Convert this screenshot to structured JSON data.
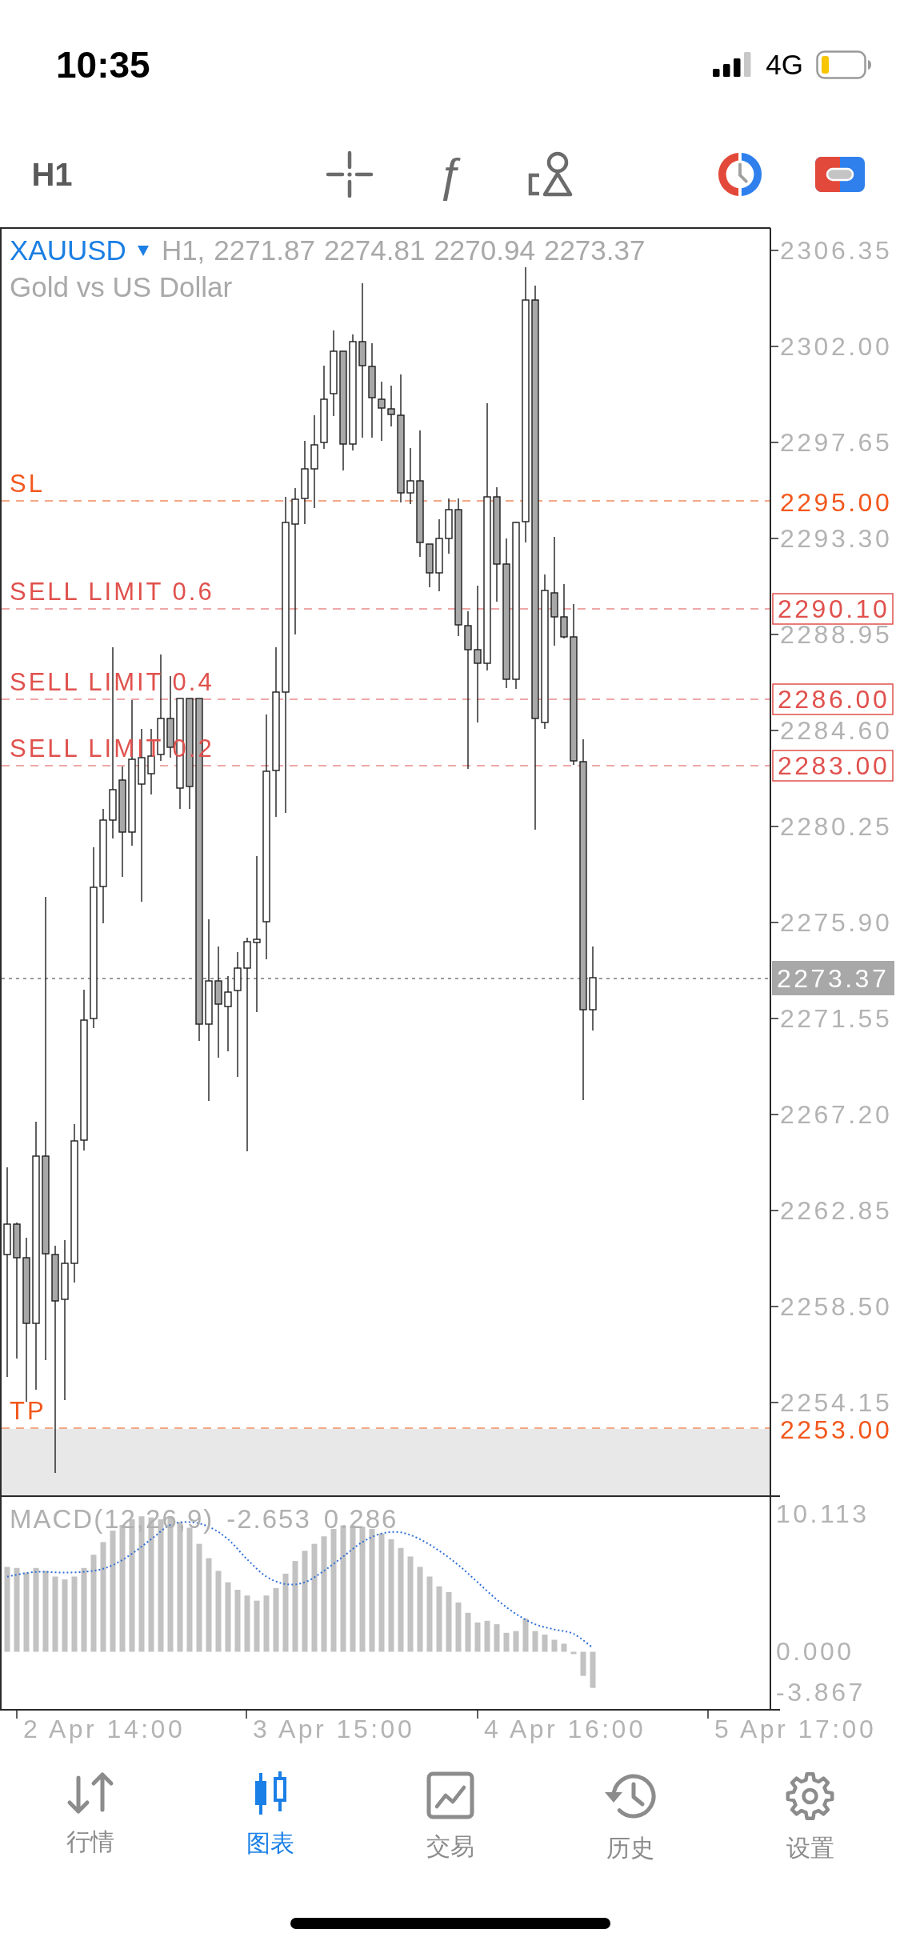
{
  "status_bar": {
    "time": "10:35",
    "network": "4G"
  },
  "toolbar": {
    "timeframe": "H1",
    "indicators_glyph": "ƒ"
  },
  "chart": {
    "header": {
      "symbol": "XAUUSD",
      "period": "H1,",
      "ohlc": [
        "2271.87",
        "2274.81",
        "2270.94",
        "2273.37"
      ],
      "description": "Gold vs US Dollar"
    },
    "price_axis": [
      "2306.35",
      "2302.00",
      "2297.65",
      "2293.30",
      "2288.95",
      "2284.60",
      "2280.25",
      "2275.90",
      "2271.55",
      "2267.20",
      "2262.85",
      "2258.50",
      "2254.15"
    ],
    "order_lines": [
      {
        "kind": "sl",
        "label": "SL",
        "price": "2295.00"
      },
      {
        "kind": "limit",
        "label": "SELL LIMIT 0.6",
        "price": "2290.10"
      },
      {
        "kind": "limit",
        "label": "SELL LIMIT 0.4",
        "price": "2286.00"
      },
      {
        "kind": "limit",
        "label": "SELL LIMIT 0.2",
        "price": "2283.00"
      },
      {
        "kind": "tp",
        "label": "TP",
        "price": "2253.00"
      }
    ],
    "current_price": "2273.37",
    "macd": {
      "title": "MACD(12,26,9)",
      "values": [
        "-2.653",
        "0.286"
      ],
      "axis": [
        "10.113",
        "0.000",
        "-3.867"
      ]
    },
    "time_axis": [
      "2 Apr 14:00",
      "3 Apr 15:00",
      "4 Apr 16:00",
      "5 Apr 17:00"
    ]
  },
  "tab_bar": [
    {
      "label": "行情",
      "selected": false
    },
    {
      "label": "图表",
      "selected": true
    },
    {
      "label": "交易",
      "selected": false
    },
    {
      "label": "历史",
      "selected": false
    },
    {
      "label": "设置",
      "selected": false
    }
  ]
}
